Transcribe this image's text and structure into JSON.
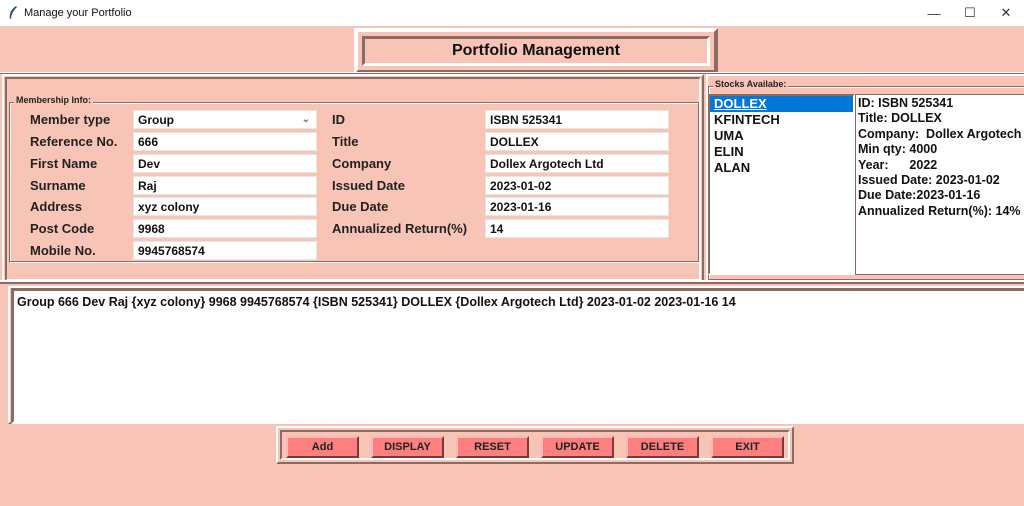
{
  "window": {
    "title": "Manage your Portfolio",
    "controls": {
      "minimize": "—",
      "maximize": "☐",
      "close": "✕"
    }
  },
  "header": {
    "title": "Portfolio Management"
  },
  "membership": {
    "frame_label": "Membership Info:",
    "member_type": {
      "label": "Member type",
      "value": "Group"
    },
    "reference_no": {
      "label": "Reference No.",
      "value": "666"
    },
    "first_name": {
      "label": "First Name",
      "value": "Dev"
    },
    "surname": {
      "label": "Surname",
      "value": "Raj"
    },
    "address": {
      "label": "Address",
      "value": "xyz colony"
    },
    "post_code": {
      "label": "Post Code",
      "value": "9968"
    },
    "mobile_no": {
      "label": "Mobile No.",
      "value": "9945768574"
    },
    "id": {
      "label": "ID",
      "value": "ISBN 525341"
    },
    "title": {
      "label": "Title",
      "value": "DOLLEX"
    },
    "company": {
      "label": "Company",
      "value": "Dollex Argotech Ltd"
    },
    "issued_date": {
      "label": "Issued Date",
      "value": "2023-01-02"
    },
    "due_date": {
      "label": "Due Date",
      "value": "2023-01-16"
    },
    "annualized_return": {
      "label": "Annualized Return(%)",
      "value": "14"
    }
  },
  "stocks": {
    "frame_label": "Stocks Availabe:",
    "items": [
      "DOLLEX",
      "KFINTECH",
      "UMA",
      "ELIN",
      "ALAN"
    ],
    "selected": "DOLLEX",
    "details": [
      "ID: ISBN 525341",
      "Title: DOLLEX",
      "Company:  Dollex Argotech Ltd",
      "Min qty: 4000",
      "Year:      2022",
      "Issued Date: 2023-01-02",
      "Due Date:2023-01-16",
      "Annualized Return(%): 14%"
    ]
  },
  "output_text": "Group 666 Dev Raj {xyz colony} 9968 9945768574 {ISBN 525341} DOLLEX {Dollex Argotech Ltd} 2023-01-02 2023-01-16 14",
  "buttons": {
    "add": "Add",
    "display": "DISPLAY",
    "reset": "RESET",
    "update": "UPDATE",
    "delete": "DELETE",
    "exit": "EXIT"
  },
  "colors": {
    "background": "#f7c4b5",
    "button": "#ff7f7f",
    "selection": "#0078d7"
  }
}
